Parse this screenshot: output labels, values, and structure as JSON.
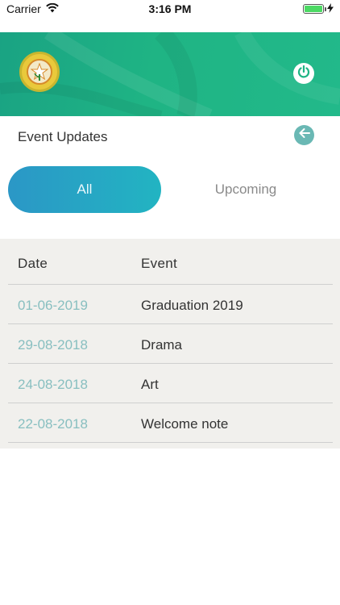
{
  "status_bar": {
    "carrier": "Carrier",
    "time": "3:16 PM",
    "battery_level": 1.0
  },
  "colors": {
    "header": "#1fb484",
    "tab_active_start": "#2b97c6",
    "tab_active_end": "#22b4c2",
    "date_text": "#88bfc0",
    "table_bg": "#f1f0ed",
    "back_button": "#6ab8b4"
  },
  "header": {
    "logo_icon": "school-emblem",
    "power_icon": "power-icon"
  },
  "page": {
    "title": "Event Updates",
    "back_icon": "arrow-left-icon"
  },
  "tabs": [
    {
      "label": "All",
      "active": true
    },
    {
      "label": "Upcoming",
      "active": false
    }
  ],
  "table": {
    "columns": [
      "Date",
      "Event"
    ],
    "rows": [
      {
        "date": "01-06-2019",
        "event": "Graduation 2019"
      },
      {
        "date": "29-08-2018",
        "event": "Drama"
      },
      {
        "date": "24-08-2018",
        "event": "Art"
      },
      {
        "date": "22-08-2018",
        "event": "Welcome note"
      }
    ]
  }
}
